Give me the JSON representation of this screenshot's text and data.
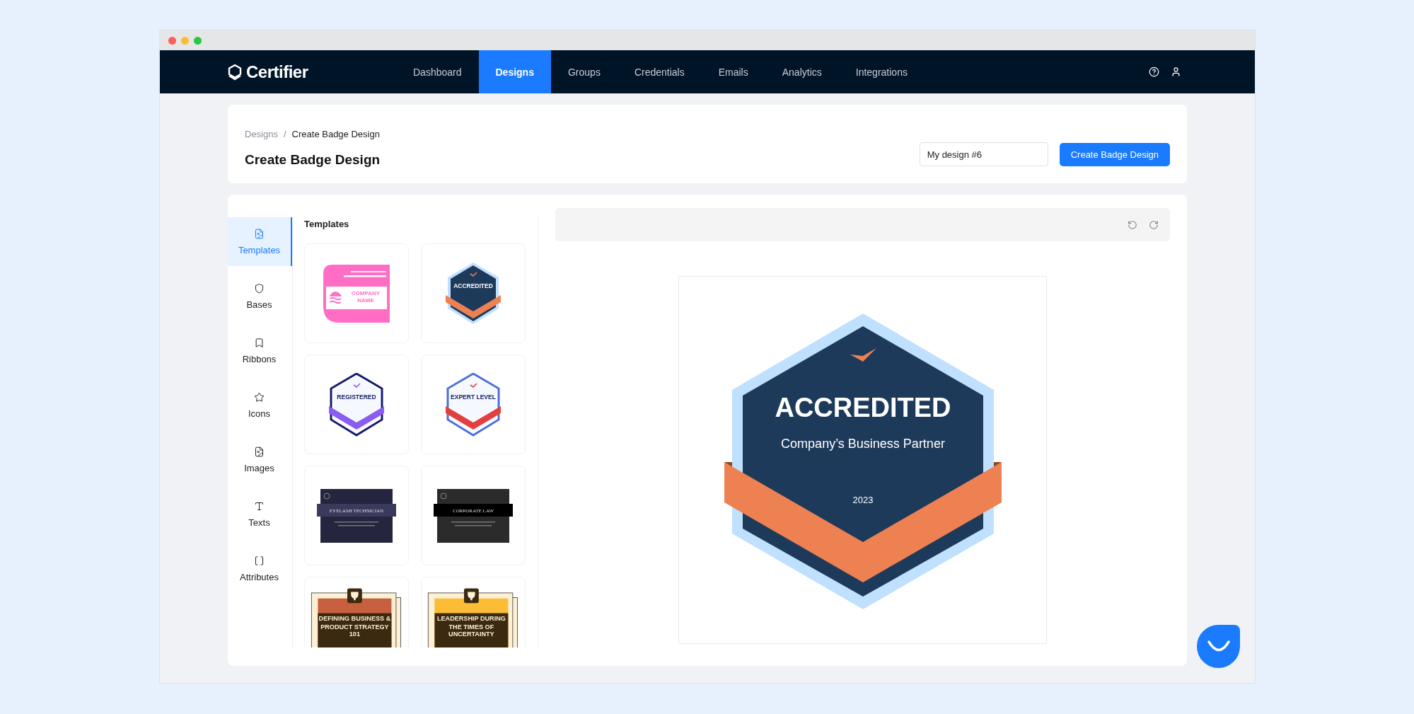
{
  "nav": {
    "logo": "Certifier",
    "items": [
      {
        "label": "Dashboard",
        "selected": false
      },
      {
        "label": "Designs",
        "selected": true
      },
      {
        "label": "Groups",
        "selected": false
      },
      {
        "label": "Credentials",
        "selected": false
      },
      {
        "label": "Emails",
        "selected": false
      },
      {
        "label": "Analytics",
        "selected": false
      },
      {
        "label": "Integrations",
        "selected": false
      }
    ]
  },
  "header": {
    "breadcrumb": [
      "Designs",
      "Create Badge Design"
    ],
    "breadcrumb_separator": "/",
    "title": "Create Badge Design",
    "name_field": {
      "value": "My design #6"
    },
    "button": "Create Badge Design"
  },
  "side_tabs": [
    {
      "kind": "templates",
      "label": "Templates",
      "selected": true
    },
    {
      "kind": "bases",
      "label": "Bases",
      "selected": false
    },
    {
      "kind": "ribbons",
      "label": "Ribbons",
      "selected": false
    },
    {
      "kind": "icons",
      "label": "Icons",
      "selected": false
    },
    {
      "kind": "images",
      "label": "Images",
      "selected": false
    },
    {
      "kind": "texts",
      "label": "Texts",
      "selected": false
    },
    {
      "kind": "attributes",
      "label": "Attributes",
      "selected": false
    }
  ],
  "templates": {
    "title": "Templates",
    "items": [
      {
        "kind": "label",
        "title": "COMPANY NAME",
        "color": "#ff6ec4"
      },
      {
        "kind": "hexagon-dark",
        "title": "ACCREDITED",
        "color": "#ee8152"
      },
      {
        "kind": "hexagon-light",
        "title": "REGISTERED",
        "color": "#8b5cf0"
      },
      {
        "kind": "hexagon-light",
        "title": "EXPERT LEVEL",
        "color": "#e2403f"
      },
      {
        "kind": "dark-certificate",
        "title": "EYELASH TECHNICIAN",
        "color": "#25253f"
      },
      {
        "kind": "dark-certificate",
        "title": "CORPORATE LAW",
        "color": "#2b2b2b"
      },
      {
        "kind": "paper-certificate",
        "title": "DEFINING BUSINESS & PRODUCT STRATEGY 101",
        "color": "#c8603f"
      },
      {
        "kind": "paper-certificate",
        "title": "LEADERSHIP DURING THE TIMES OF UNCERTAINTY",
        "color": "#fbbd35"
      }
    ]
  },
  "canvas": {
    "badge": {
      "title": "ACCREDITED",
      "subtitle": "Company’s Business Partner",
      "year": "2023"
    }
  }
}
